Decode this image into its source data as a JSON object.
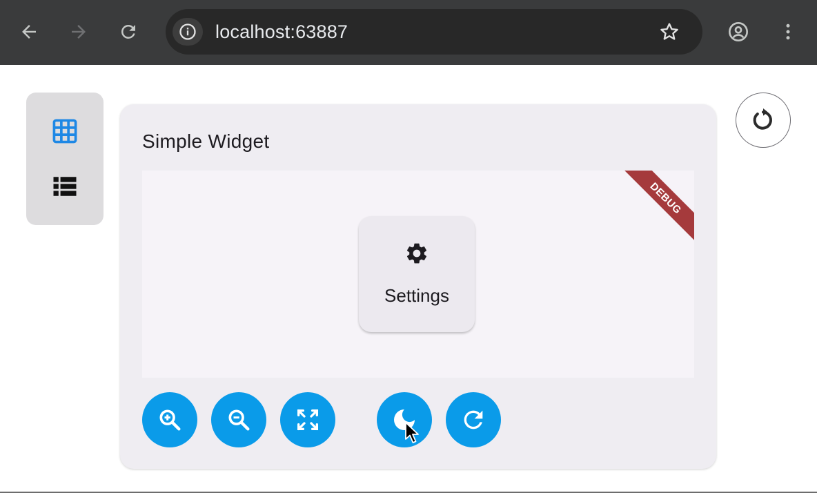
{
  "browser": {
    "url": "localhost:63887",
    "back_icon": "arrow-left-icon",
    "forward_icon": "arrow-right-icon",
    "reload_icon": "reload-icon",
    "info_icon": "info-icon",
    "bookmark_icon": "star-icon",
    "profile_icon": "account-circle-icon",
    "menu_icon": "more-vert-icon"
  },
  "rail": {
    "items": [
      {
        "icon": "grid-view-icon",
        "selected": true
      },
      {
        "icon": "list-view-icon",
        "selected": false
      }
    ]
  },
  "card": {
    "title": "Simple Widget",
    "debug_banner": "DEBUG",
    "settings_label": "Settings",
    "settings_icon": "gear-icon"
  },
  "toolbar": {
    "buttons": [
      {
        "icon": "zoom-in-icon"
      },
      {
        "icon": "zoom-out-icon"
      },
      {
        "icon": "fullscreen-icon"
      },
      {
        "icon": "dark-mode-icon"
      },
      {
        "icon": "refresh-icon"
      }
    ]
  },
  "colors": {
    "accent": "#0a9be9",
    "selected_icon": "#1e88e5",
    "debug_banner": "#a53a3c",
    "card_bg": "#efedf2",
    "browser_bar": "#3a3b3c"
  }
}
